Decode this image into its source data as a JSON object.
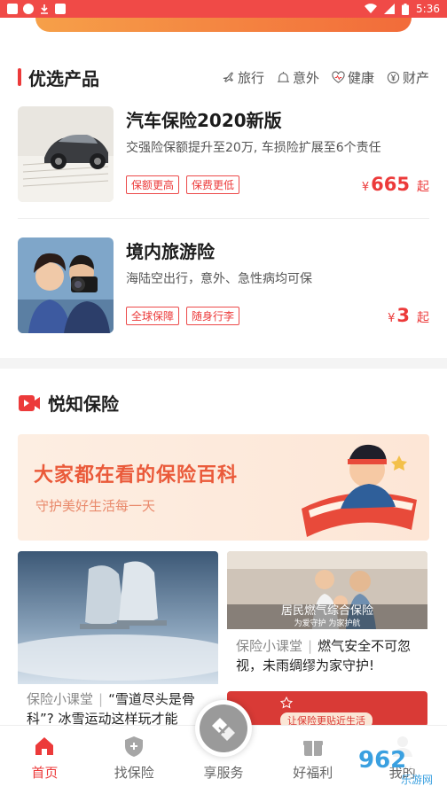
{
  "status_bar": {
    "time": "5:36",
    "icons": [
      "notification-icon",
      "shield-app-icon",
      "download-icon",
      "app-a-icon"
    ]
  },
  "featured": {
    "title": "优选产品",
    "categories": [
      {
        "label": "旅行",
        "icon": "plane-icon"
      },
      {
        "label": "意外",
        "icon": "alert-icon"
      },
      {
        "label": "健康",
        "icon": "heart-icon"
      },
      {
        "label": "财产",
        "icon": "yen-icon"
      }
    ],
    "products": [
      {
        "title": "汽车保险2020新版",
        "desc": "交强险保额提升至20万, 车损险扩展至6个责任",
        "tags": [
          "保额更高",
          "保费更低"
        ],
        "currency": "¥",
        "price": "665",
        "price_suffix": "起"
      },
      {
        "title": "境内旅游险",
        "desc": "海陆空出行，意外、急性病均可保",
        "tags": [
          "全球保障",
          "随身行李"
        ],
        "currency": "¥",
        "price": "3",
        "price_suffix": "起"
      }
    ]
  },
  "knowledge": {
    "title": "悦知保险",
    "banner": {
      "title": "大家都在看的保险百科",
      "subtitle": "守护美好生活每一天"
    },
    "articles": [
      {
        "category": "保险小课堂",
        "text": "“雪道尽头是骨科”? 冰雪运动这样玩才能"
      },
      {
        "category": "保险小课堂",
        "text": "燃气安全不可忽视，未雨绸缪为家守护!",
        "image_caption": "居民燃气综合保险",
        "image_sub": "为爱守护 为家护航"
      },
      {
        "image_caption": "让保险更贴近生活"
      }
    ]
  },
  "bottom_nav": [
    {
      "label": "首页",
      "icon": "home-icon",
      "active": true
    },
    {
      "label": "找保险",
      "icon": "shield-plus-icon",
      "active": false
    },
    {
      "label": "享服务",
      "icon": "handshake-icon",
      "active": false
    },
    {
      "label": "好福利",
      "icon": "gift-icon",
      "active": false
    },
    {
      "label": "我的",
      "icon": "profile-icon",
      "active": false
    }
  ],
  "watermark": {
    "text": "962",
    "sub": "乐游网"
  },
  "colors": {
    "brand": "#ec3a3a",
    "status_bar": "#f04a47"
  }
}
